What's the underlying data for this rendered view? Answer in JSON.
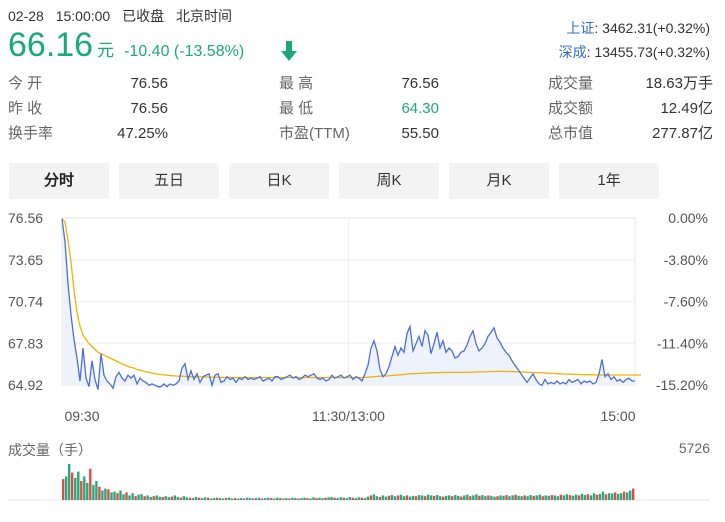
{
  "status": {
    "date": "02-28",
    "time": "15:00:00",
    "state": "已收盘",
    "zone": "北京时间"
  },
  "quote": {
    "price": "66.16",
    "unit": "元",
    "change": "-10.40 (-13.58%)",
    "direction": "down",
    "color": "#1aa97b"
  },
  "indices": [
    {
      "name": "上证",
      "value": ":  3462.31(+0.32%)"
    },
    {
      "name": "深成",
      "value": ":  13455.73(+0.32%)"
    }
  ],
  "stats": {
    "open": {
      "label": "今    开",
      "value": "76.56"
    },
    "prev_close": {
      "label": "昨    收",
      "value": "76.56"
    },
    "turnover": {
      "label": "换手率",
      "value": "47.25%"
    },
    "high": {
      "label": "最    高",
      "value": "76.56"
    },
    "low": {
      "label": "最    低",
      "value": "64.30"
    },
    "pe": {
      "label": "市盈(TTM)",
      "value": "55.50"
    },
    "volume": {
      "label": "成交量",
      "value": "18.63万手"
    },
    "amount": {
      "label": "成交额",
      "value": "12.49亿"
    },
    "market_cap": {
      "label": "总市值",
      "value": "277.87亿"
    }
  },
  "tabs": [
    {
      "label": "分时",
      "active": true
    },
    {
      "label": "五日",
      "active": false
    },
    {
      "label": "日K",
      "active": false
    },
    {
      "label": "周K",
      "active": false
    },
    {
      "label": "月K",
      "active": false
    },
    {
      "label": "1年",
      "active": false
    }
  ],
  "volume_panel": {
    "label": "成交量（手）",
    "max": "5726"
  },
  "footer_text": "...",
  "chart_data": {
    "type": "line",
    "y_ticks": [
      "76.56",
      "73.65",
      "70.74",
      "67.83",
      "64.92"
    ],
    "y_pct_ticks": [
      "0.00%",
      "-3.80%",
      "-7.60%",
      "-11.40%",
      "-15.20%"
    ],
    "x_ticks": [
      "09:30",
      "11:30/13:00",
      "15:00"
    ],
    "ylim": [
      64.92,
      76.56
    ],
    "series": [
      {
        "color": "#4a6fd8",
        "values": [
          76.5,
          74.9,
          72.0,
          69.8,
          68.1,
          66.8,
          65.2,
          67.5,
          65.4,
          64.8,
          66.6,
          65.3,
          64.6,
          67.1,
          65.6,
          65.2,
          65.0,
          64.7,
          65.5,
          65.8,
          65.4,
          65.2,
          65.6,
          65.4,
          65.6,
          65.0,
          65.4,
          65.2,
          65.1,
          64.9,
          65.0,
          64.9,
          64.8,
          64.8,
          65.0,
          64.8,
          65.0,
          64.9,
          65.0,
          65.2,
          66.1,
          66.4,
          65.3,
          65.9,
          65.3,
          65.7,
          65.1,
          65.5,
          65.6,
          65.7,
          64.9,
          65.6,
          65.7,
          65.1,
          65.2,
          65.5,
          65.3,
          65.4,
          65.1,
          65.4,
          65.3,
          65.5,
          65.3,
          65.4,
          65.3,
          65.4,
          65.5,
          65.2,
          65.3,
          65.4,
          65.2,
          65.5,
          65.5,
          65.3,
          65.4,
          65.5,
          65.6,
          65.4,
          65.5,
          65.3,
          65.4,
          65.6,
          65.5,
          65.6,
          65.7,
          65.4,
          65.3,
          65.4,
          65.2,
          65.3,
          65.6,
          65.4,
          65.5,
          65.6,
          65.4,
          65.5,
          65.6,
          65.3,
          65.5,
          65.4,
          65.2,
          65.7,
          66.3,
          67.5,
          68.0,
          67.3,
          66.0,
          65.5,
          65.7,
          66.2,
          66.9,
          67.6,
          67.0,
          67.5,
          67.2,
          68.5,
          69.0,
          67.3,
          67.8,
          68.3,
          67.6,
          68.7,
          68.4,
          67.1,
          67.8,
          68.6,
          67.5,
          68.0,
          67.2,
          67.5,
          67.3,
          66.8,
          66.9,
          67.2,
          67.3,
          67.7,
          68.3,
          68.7,
          67.8,
          67.3,
          67.5,
          67.8,
          68.3,
          68.6,
          68.9,
          68.2,
          67.9,
          67.5,
          67.2,
          67.0,
          66.6,
          66.3,
          66.0,
          65.7,
          65.4,
          65.1,
          65.4,
          65.7,
          65.3,
          65.0,
          64.9,
          65.3,
          65.0,
          65.1,
          65.0,
          65.2,
          65.0,
          65.1,
          65.0,
          65.3,
          65.1,
          65.2,
          65.3,
          65.0,
          65.2,
          65.1,
          65.2,
          65.0,
          65.1,
          65.7,
          66.7,
          65.5,
          65.7,
          65.3,
          65.5,
          65.2,
          65.3,
          65.1,
          65.3,
          65.4,
          65.2,
          65.2
        ]
      },
      {
        "color": "#f0b400",
        "values": [
          76.5,
          76.3,
          75.0,
          73.5,
          71.5,
          70.0,
          69.0,
          68.4,
          68.1,
          67.8,
          67.6,
          67.4,
          67.2,
          67.1,
          67.0,
          66.9,
          66.8,
          66.7,
          66.6,
          66.5,
          66.4,
          66.3,
          66.2,
          66.15,
          66.1,
          66.0,
          65.95,
          65.9,
          65.85,
          65.8,
          65.75,
          65.7,
          65.68,
          65.65,
          65.62,
          65.6,
          65.58,
          65.56,
          65.55,
          65.54,
          65.53,
          65.52,
          65.51,
          65.5,
          65.5,
          65.5,
          65.49,
          65.48,
          65.48,
          65.47,
          65.47,
          65.46,
          65.46,
          65.45,
          65.45,
          65.45,
          65.45,
          65.44,
          65.44,
          65.44,
          65.44,
          65.44,
          65.44,
          65.44,
          65.44,
          65.44,
          65.44,
          65.44,
          65.44,
          65.44,
          65.44,
          65.44,
          65.44,
          65.44,
          65.44,
          65.44,
          65.44,
          65.44,
          65.44,
          65.44,
          65.44,
          65.44,
          65.44,
          65.44,
          65.44,
          65.44,
          65.44,
          65.44,
          65.44,
          65.44,
          65.44,
          65.44,
          65.44,
          65.44,
          65.44,
          65.44,
          65.44,
          65.44,
          65.44,
          65.44,
          65.44,
          65.45,
          65.46,
          65.48,
          65.5,
          65.52,
          65.53,
          65.54,
          65.55,
          65.56,
          65.58,
          65.6,
          65.62,
          65.64,
          65.66,
          65.68,
          65.7,
          65.71,
          65.72,
          65.73,
          65.74,
          65.75,
          65.76,
          65.77,
          65.78,
          65.78,
          65.79,
          65.79,
          65.8,
          65.8,
          65.8,
          65.8,
          65.8,
          65.8,
          65.8,
          65.8,
          65.81,
          65.82,
          65.82,
          65.83,
          65.83,
          65.84,
          65.85,
          65.86,
          65.86,
          65.87,
          65.87,
          65.87,
          65.87,
          65.86,
          65.86,
          65.85,
          65.84,
          65.83,
          65.82,
          65.81,
          65.8,
          65.79,
          65.78,
          65.77,
          65.76,
          65.75,
          65.74,
          65.73,
          65.72,
          65.71,
          65.7,
          65.69,
          65.68,
          65.67,
          65.66,
          65.66,
          65.65,
          65.65,
          65.64,
          65.64,
          65.63,
          65.63,
          65.62,
          65.62,
          65.62,
          65.62,
          65.62,
          65.62,
          65.62,
          65.62,
          65.62,
          65.62,
          65.62,
          65.62,
          65.62,
          65.62,
          65.62,
          65.62
        ]
      }
    ],
    "volume": [
      0.55,
      0.62,
      0.95,
      0.72,
      0.58,
      0.75,
      0.5,
      0.62,
      0.45,
      0.82,
      0.4,
      0.5,
      0.35,
      0.25,
      0.3,
      0.28,
      0.2,
      0.22,
      0.18,
      0.25,
      0.15,
      0.2,
      0.12,
      0.18,
      0.1,
      0.14,
      0.15,
      0.1,
      0.12,
      0.08,
      0.1,
      0.12,
      0.09,
      0.08,
      0.1,
      0.07,
      0.09,
      0.12,
      0.08,
      0.06,
      0.1,
      0.07,
      0.06,
      0.05,
      0.08,
      0.06,
      0.05,
      0.07,
      0.06,
      0.04,
      0.05,
      0.06,
      0.05,
      0.04,
      0.05,
      0.06,
      0.04,
      0.05,
      0.04,
      0.05,
      0.04,
      0.06,
      0.05,
      0.04,
      0.05,
      0.06,
      0.04,
      0.05,
      0.06,
      0.05,
      0.04,
      0.06,
      0.05,
      0.04,
      0.05,
      0.04,
      0.06,
      0.05,
      0.04,
      0.05,
      0.06,
      0.05,
      0.04,
      0.07,
      0.05,
      0.06,
      0.05,
      0.06,
      0.07,
      0.08,
      0.06,
      0.05,
      0.07,
      0.06,
      0.05,
      0.08,
      0.06,
      0.05,
      0.07,
      0.06,
      0.05,
      0.09,
      0.12,
      0.15,
      0.1,
      0.08,
      0.12,
      0.09,
      0.11,
      0.13,
      0.1,
      0.12,
      0.14,
      0.1,
      0.12,
      0.09,
      0.11,
      0.1,
      0.13,
      0.12,
      0.1,
      0.14,
      0.12,
      0.11,
      0.13,
      0.1,
      0.09,
      0.11,
      0.12,
      0.1,
      0.13,
      0.11,
      0.09,
      0.12,
      0.14,
      0.1,
      0.12,
      0.15,
      0.11,
      0.13,
      0.1,
      0.12,
      0.11,
      0.09,
      0.1,
      0.12,
      0.11,
      0.13,
      0.1,
      0.12,
      0.14,
      0.11,
      0.1,
      0.12,
      0.1,
      0.13,
      0.11,
      0.12,
      0.14,
      0.1,
      0.12,
      0.11,
      0.13,
      0.12,
      0.1,
      0.14,
      0.12,
      0.15,
      0.13,
      0.11,
      0.14,
      0.12,
      0.16,
      0.13,
      0.15,
      0.12,
      0.18,
      0.14,
      0.16,
      0.22,
      0.15,
      0.18,
      0.17,
      0.2,
      0.16,
      0.18,
      0.22,
      0.2,
      0.25,
      0.3
    ]
  }
}
